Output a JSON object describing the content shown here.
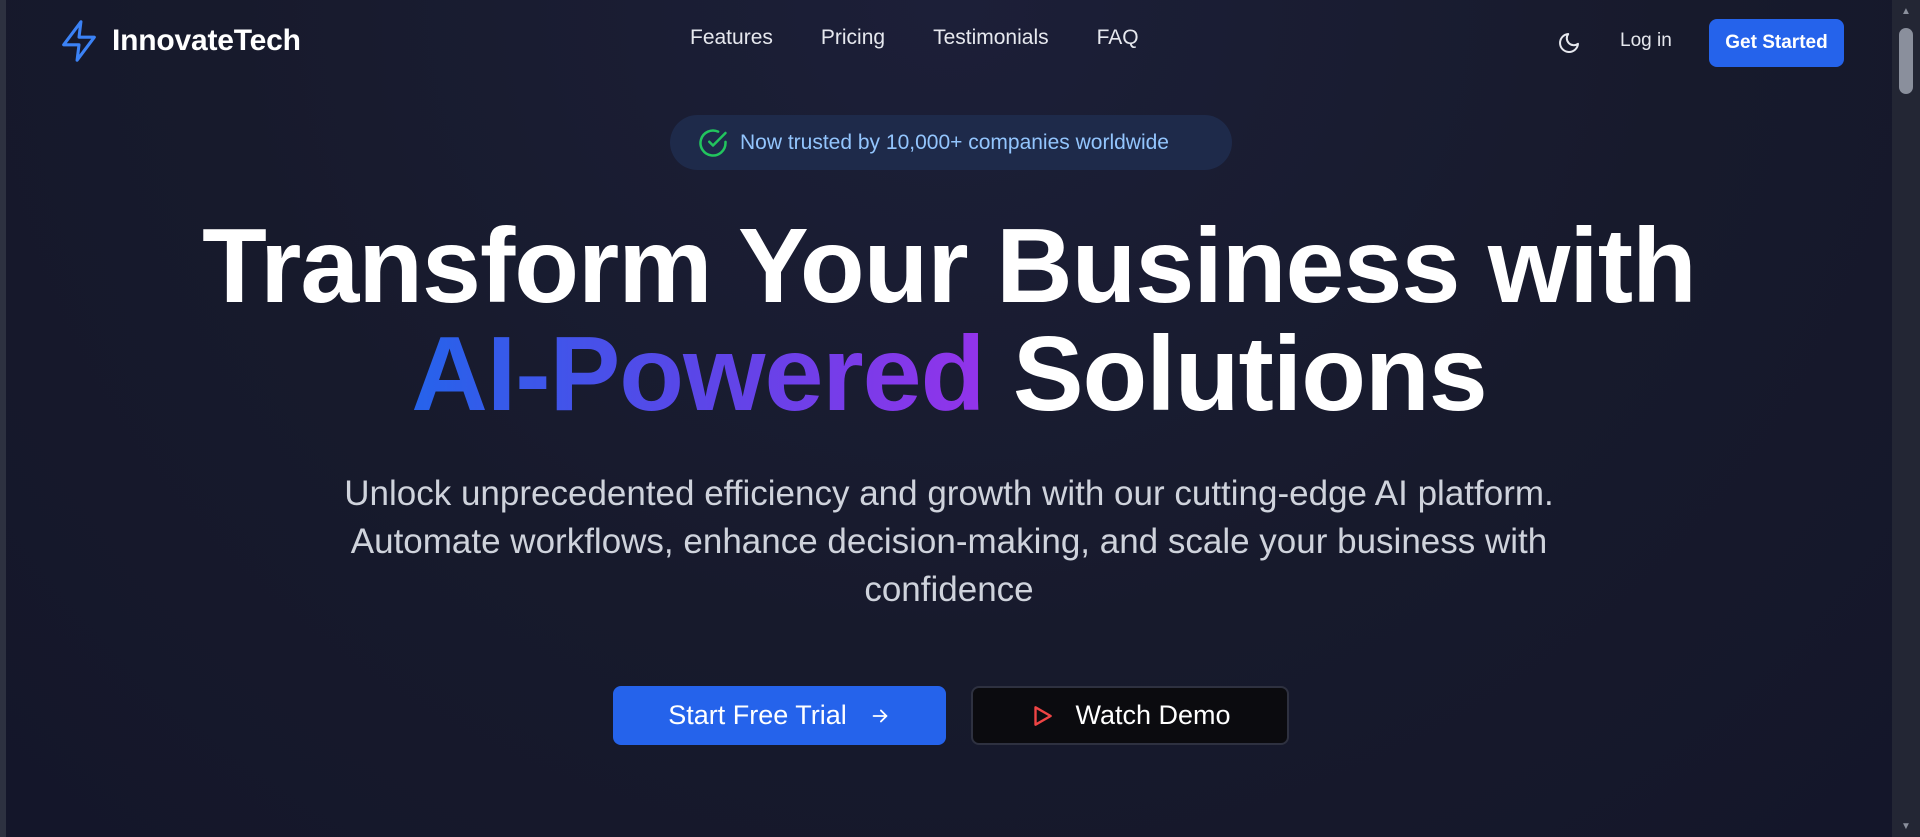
{
  "brand": {
    "name": "InnovateTech",
    "icon": "lightning-bolt-icon",
    "accent_color": "#2563eb"
  },
  "nav": {
    "items": [
      {
        "label": "Features"
      },
      {
        "label": "Pricing"
      },
      {
        "label": "Testimonials"
      },
      {
        "label": "FAQ"
      }
    ]
  },
  "header_actions": {
    "theme_icon": "moon-icon",
    "login_label": "Log in",
    "get_started_label": "Get Started"
  },
  "hero": {
    "badge_icon": "check-circle-icon",
    "badge_text": "Now trusted by 10,000+ companies worldwide",
    "title_line1": "Transform Your Business with",
    "title_highlight": "AI-Powered",
    "title_line2_rest": "Solutions",
    "subtitle": "Unlock unprecedented efficiency and growth with our cutting-edge AI platform. Automate workflows, enhance decision-making, and scale your business with confidence",
    "primary_cta": "Start Free Trial",
    "primary_cta_icon": "arrow-right-icon",
    "secondary_cta": "Watch Demo",
    "secondary_cta_icon": "play-icon"
  },
  "colors": {
    "background": "#1a1a2e",
    "primary": "#2563eb",
    "gradient_start": "#2563eb",
    "gradient_end": "#9333ea",
    "badge_text": "#93c5fd",
    "check_green": "#22c55e",
    "play_red": "#ef4444"
  }
}
